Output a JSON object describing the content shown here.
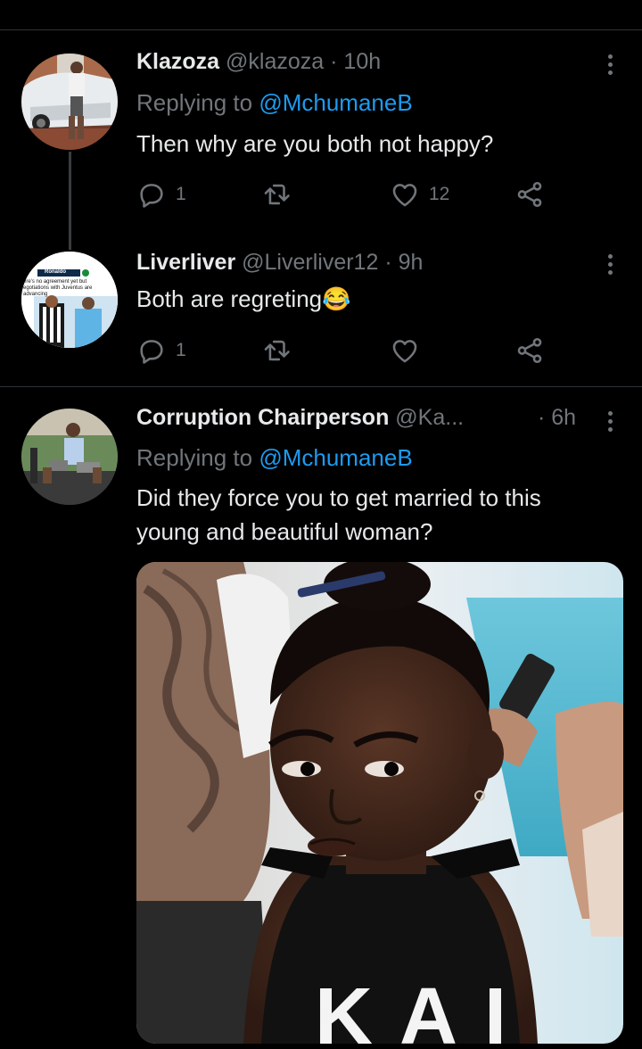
{
  "tweets": [
    {
      "name": "Klazoza",
      "handle": "@klazoza",
      "time": "· 10h",
      "replying_prefix": "Replying to",
      "replying_to": "@MchumaneB",
      "text": "Then why are you both not happy?",
      "replies": "1",
      "retweets": "",
      "likes": "12"
    },
    {
      "name": "Liverliver",
      "handle": "@Liverliver12",
      "time": "· 9h",
      "text": "Both are regreting😂",
      "replies": "1",
      "retweets": "",
      "likes": ""
    },
    {
      "name": "Corruption Chairperson",
      "handle": "@Ka...",
      "time": "· 6h",
      "replying_prefix": "Replying to",
      "replying_to": "@MchumaneB",
      "text_line1": "Did they force you to get married to this",
      "text_line2": "young and beautiful woman?",
      "media_letters": "KAI"
    }
  ],
  "avatar2_text": {
    "tag": "Ronaldo",
    "line1": "ere's no agreement yet but",
    "line2": "egotiations with Juventus are",
    "line3": "advancing"
  },
  "icons": [
    "reply-icon",
    "retweet-icon",
    "like-icon",
    "share-icon",
    "more-icon"
  ],
  "colors": {
    "background": "#000000",
    "text": "#e7e9ea",
    "muted": "#71767b",
    "link": "#1d9bf0",
    "divider": "#2f3336"
  }
}
